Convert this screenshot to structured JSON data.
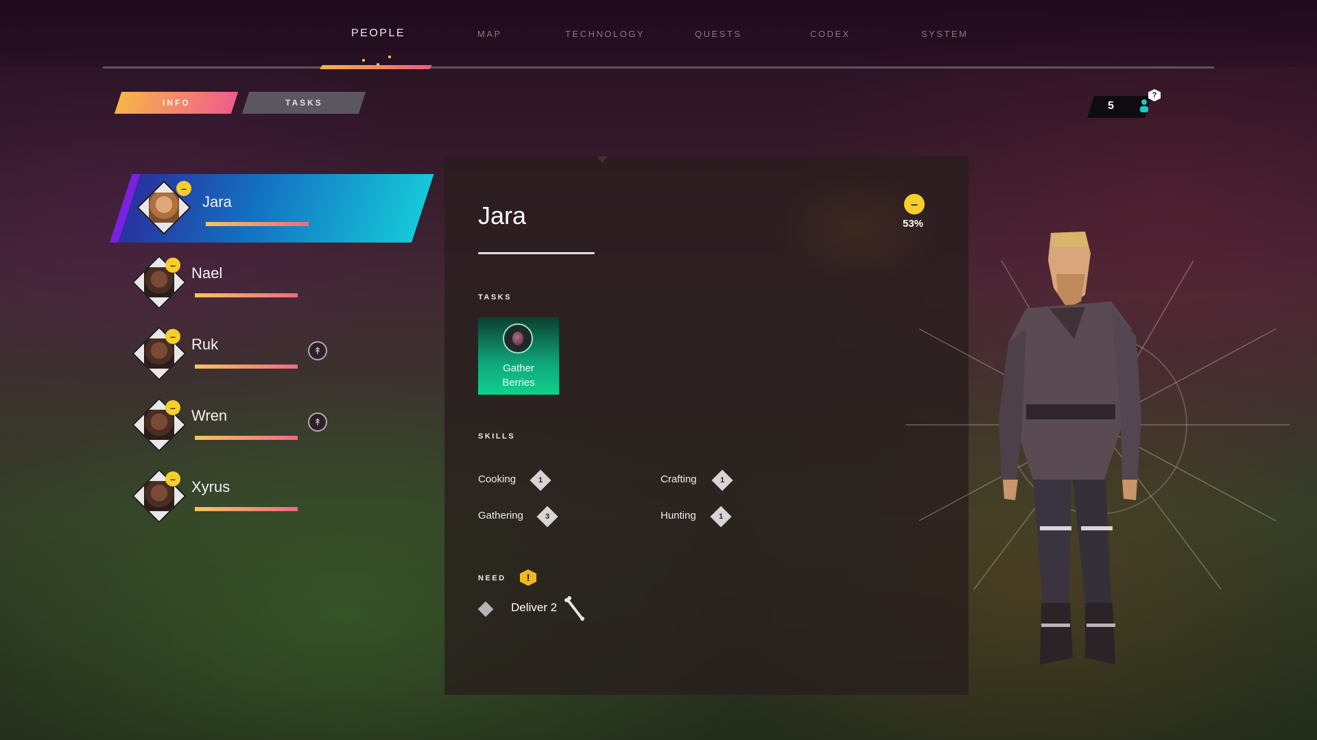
{
  "nav": {
    "tabs": [
      {
        "label": "PEOPLE",
        "active": true
      },
      {
        "label": "MAP",
        "active": false
      },
      {
        "label": "TECHNOLOGY",
        "active": false
      },
      {
        "label": "QUESTS",
        "active": false
      },
      {
        "label": "CODEX",
        "active": false
      },
      {
        "label": "SYSTEM",
        "active": false
      }
    ]
  },
  "subtabs": {
    "info": "INFO",
    "tasks": "TASKS"
  },
  "population": {
    "count": "5",
    "help": "?"
  },
  "people": [
    {
      "name": "Jara",
      "mood": "neutral",
      "selected": true,
      "has_task_icon": false
    },
    {
      "name": "Nael",
      "mood": "neutral",
      "selected": false,
      "has_task_icon": false
    },
    {
      "name": "Ruk",
      "mood": "neutral",
      "selected": false,
      "has_task_icon": true
    },
    {
      "name": "Wren",
      "mood": "neutral",
      "selected": false,
      "has_task_icon": true
    },
    {
      "name": "Xyrus",
      "mood": "neutral",
      "selected": false,
      "has_task_icon": false
    }
  ],
  "detail": {
    "name": "Jara",
    "mood_percent": "53%",
    "tasks_label": "TASKS",
    "task": {
      "line1": "Gather",
      "line2": "Berries",
      "icon": "berry-icon"
    },
    "skills_label": "SKILLS",
    "skills": [
      {
        "name": "Cooking",
        "level": "1"
      },
      {
        "name": "Crafting",
        "level": "1"
      },
      {
        "name": "Gathering",
        "level": "3"
      },
      {
        "name": "Hunting",
        "level": "1"
      }
    ],
    "need_label": "NEED",
    "need_badge": "!",
    "need_text": "Deliver 2",
    "need_icon": "bone-icon"
  },
  "colors": {
    "accent_gradient_start": "#f6c65a",
    "accent_gradient_end": "#f06a82",
    "selected_card_start": "#2a2e9c",
    "selected_card_end": "#16c8d8",
    "task_card": "#10d08e",
    "mood": "#f6cf2a"
  }
}
